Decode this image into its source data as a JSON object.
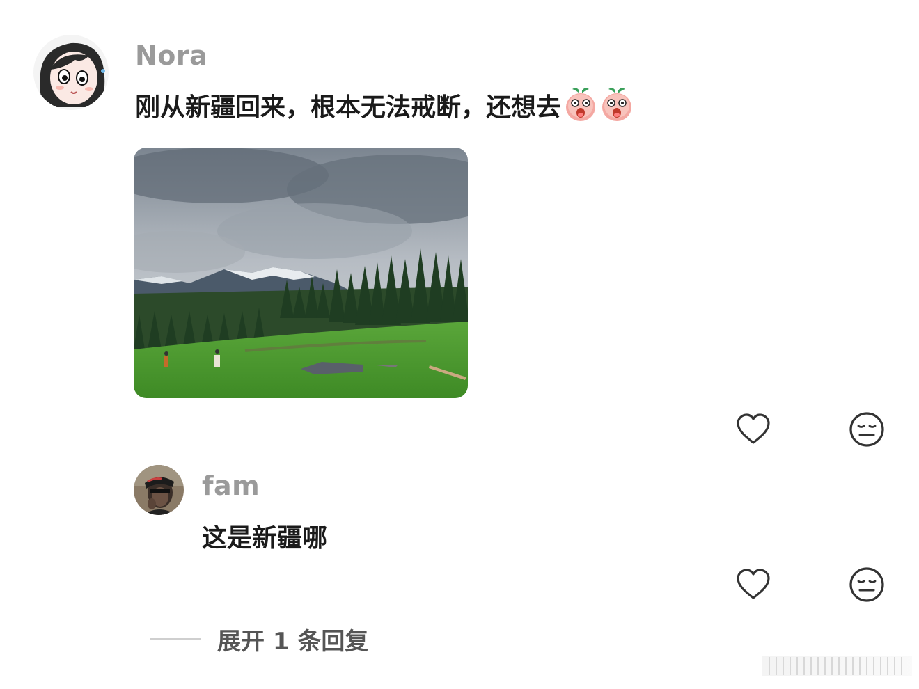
{
  "comment": {
    "username": "Nora",
    "text": "刚从新疆回来，根本无法戒断，还想去",
    "emojis": [
      "peach-surprised-emoji",
      "peach-surprised-emoji"
    ],
    "photo_alt": "photo-grassland-icon"
  },
  "reply": {
    "username": "fam",
    "text": "这是新疆哪"
  },
  "expand": {
    "label": "展开 1 条回复"
  },
  "icons": {
    "like": "heart-icon",
    "dislike": "meh-face-icon"
  },
  "colors": {
    "username": "#9a9a9a",
    "text": "#1a1a1a",
    "icon": "#333333",
    "expand_text": "#555555"
  }
}
